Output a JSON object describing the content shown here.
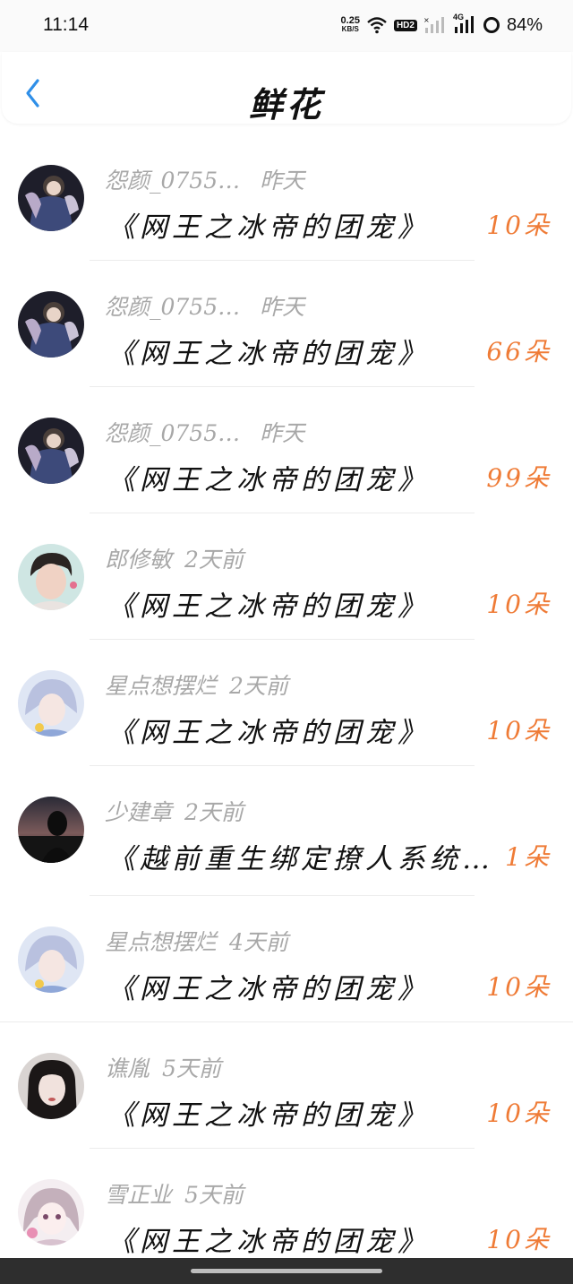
{
  "status_bar": {
    "time": "11:14",
    "net_speed_value": "0.25",
    "net_speed_unit": "KB/S",
    "hd_label": "HD2",
    "network_label": "4G",
    "battery": "84%"
  },
  "header": {
    "title": "鲜花",
    "back_icon": "chevron-left-icon",
    "accent_color": "#2f8fe8"
  },
  "colors": {
    "flower_count": "#ef7b36",
    "meta_text": "#a8a8a8"
  },
  "records": [
    {
      "user": "怨颜_0755…",
      "time": "昨天",
      "book": "《网王之冰帝的团宠》",
      "count": "10朵",
      "avatar": "anime-boy-avatar"
    },
    {
      "user": "怨颜_0755…",
      "time": "昨天",
      "book": "《网王之冰帝的团宠》",
      "count": "66朵",
      "avatar": "anime-boy-avatar"
    },
    {
      "user": "怨颜_0755…",
      "time": "昨天",
      "book": "《网王之冰帝的团宠》",
      "count": "99朵",
      "avatar": "anime-boy-avatar"
    },
    {
      "user": "郎修敏",
      "time": "2天前",
      "book": "《网王之冰帝的团宠》",
      "count": "10朵",
      "avatar": "woman-photo-avatar"
    },
    {
      "user": "星点想摆烂",
      "time": "2天前",
      "book": "《网王之冰帝的团宠》",
      "count": "10朵",
      "avatar": "anime-girl-avatar"
    },
    {
      "user": "少建章",
      "time": "2天前",
      "book": "《越前重生绑定撩人系统…",
      "count": "1朵",
      "avatar": "sunset-avatar"
    },
    {
      "user": "星点想摆烂",
      "time": "4天前",
      "book": "《网王之冰帝的团宠》",
      "count": "10朵",
      "avatar": "anime-girl-avatar"
    },
    {
      "user": "谯胤",
      "time": "5天前",
      "book": "《网王之冰帝的团宠》",
      "count": "10朵",
      "avatar": "girl-photo-avatar"
    },
    {
      "user": "雪正业",
      "time": "5天前",
      "book": "《网王之冰帝的团宠》",
      "count": "10朵",
      "avatar": "pink-anime-avatar"
    }
  ]
}
